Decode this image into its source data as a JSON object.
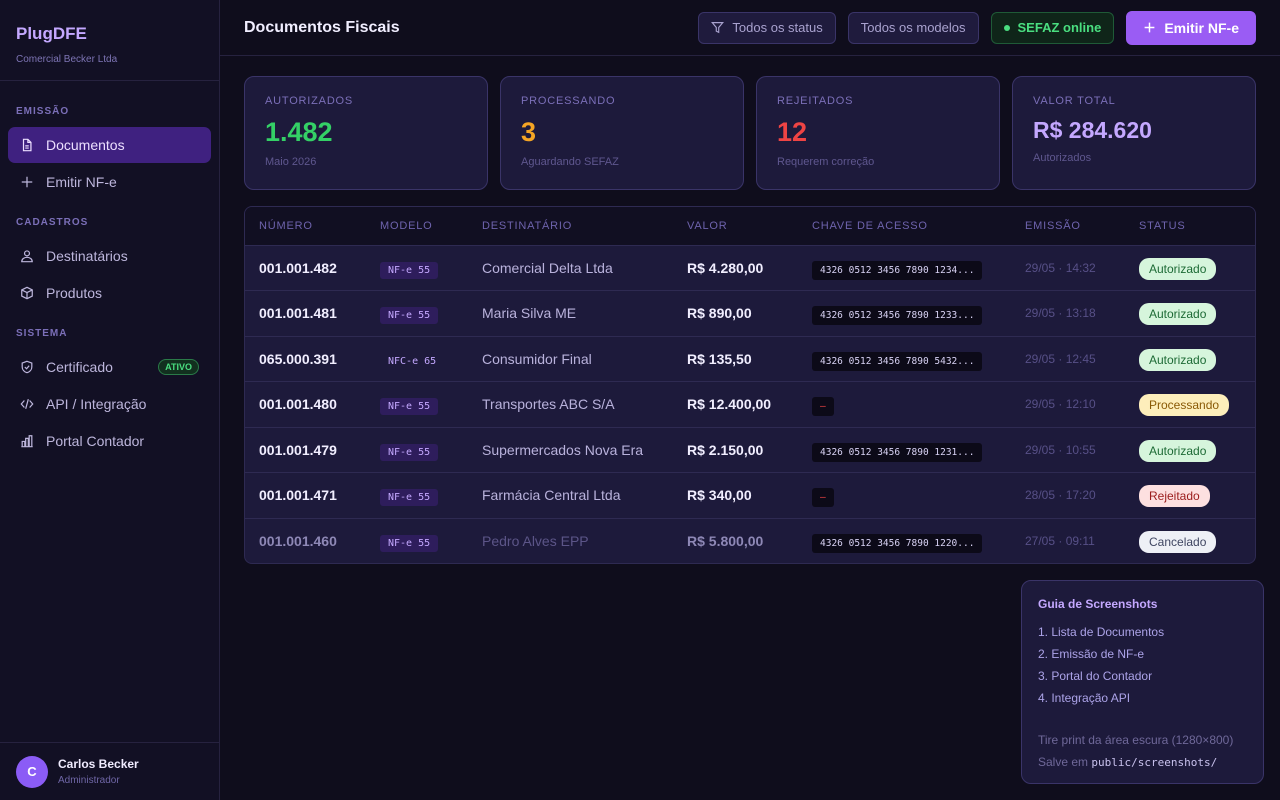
{
  "brand": {
    "name": "PlugDFE",
    "company": "Comercial Becker Ltda"
  },
  "sidebar": {
    "sections": [
      "EMISSÃO",
      "CADASTROS",
      "SISTEMA"
    ],
    "items": [
      {
        "label": "Documentos",
        "icon": "document-icon"
      },
      {
        "label": "Emitir NF-e",
        "icon": "plus-icon"
      },
      {
        "label": "Destinatários",
        "icon": "users-icon"
      },
      {
        "label": "Produtos",
        "icon": "box-icon"
      },
      {
        "label": "Certificado",
        "icon": "shield-icon",
        "badge": "ATIVO"
      },
      {
        "label": "API / Integração",
        "icon": "code-icon"
      },
      {
        "label": "Portal Contador",
        "icon": "bar-chart-icon"
      }
    ]
  },
  "user": {
    "initial": "C",
    "name": "Carlos Becker",
    "role": "Administrador"
  },
  "header": {
    "title": "Documentos Fiscais",
    "filter_status": "Todos os status",
    "filter_models": "Todos os modelos",
    "sefaz": "SEFAZ online",
    "emit": "Emitir NF-e"
  },
  "stats": [
    {
      "label": "AUTORIZADOS",
      "value": "1.482",
      "sub": "Maio 2026"
    },
    {
      "label": "PROCESSANDO",
      "value": "3",
      "sub": "Aguardando SEFAZ"
    },
    {
      "label": "REJEITADOS",
      "value": "12",
      "sub": "Requerem correção"
    },
    {
      "label": "VALOR TOTAL",
      "value": "R$ 284.620",
      "sub": "Autorizados"
    }
  ],
  "table": {
    "columns": [
      "NÚMERO",
      "MODELO",
      "DESTINATÁRIO",
      "VALOR",
      "CHAVE DE ACESSO",
      "EMISSÃO",
      "STATUS"
    ],
    "rows": [
      {
        "num": "001.001.482",
        "model": "NF-e 55",
        "dest": "Comercial Delta Ltda",
        "value": "R$ 4.280,00",
        "key": "4326 0512 3456 7890 1234...",
        "date": "29/05 · 14:32",
        "status": "Autorizado"
      },
      {
        "num": "001.001.481",
        "model": "NF-e 55",
        "dest": "Maria Silva ME",
        "value": "R$ 890,00",
        "key": "4326 0512 3456 7890 1233...",
        "date": "29/05 · 13:18",
        "status": "Autorizado"
      },
      {
        "num": "065.000.391",
        "model": "NFC-e 65",
        "dest": "Consumidor Final",
        "value": "R$ 135,50",
        "key": "4326 0512 3456 7890 5432...",
        "date": "29/05 · 12:45",
        "status": "Autorizado"
      },
      {
        "num": "001.001.480",
        "model": "NF-e 55",
        "dest": "Transportes ABC S/A",
        "value": "R$ 12.400,00",
        "key": "—",
        "date": "29/05 · 12:10",
        "status": "Processando"
      },
      {
        "num": "001.001.479",
        "model": "NF-e 55",
        "dest": "Supermercados Nova Era",
        "value": "R$ 2.150,00",
        "key": "4326 0512 3456 7890 1231...",
        "date": "29/05 · 10:55",
        "status": "Autorizado"
      },
      {
        "num": "001.001.471",
        "model": "NF-e 55",
        "dest": "Farmácia Central Ltda",
        "value": "R$ 340,00",
        "key": "—",
        "date": "28/05 · 17:20",
        "status": "Rejeitado"
      },
      {
        "num": "001.001.460",
        "model": "NF-e 55",
        "dest": "Pedro Alves EPP",
        "value": "R$ 5.800,00",
        "key": "4326 0512 3456 7890 1220...",
        "date": "27/05 · 09:11",
        "status": "Cancelado"
      }
    ]
  },
  "guide": {
    "title": "Guia de Screenshots",
    "items": [
      "1. Lista de Documentos",
      "2. Emissão de NF-e",
      "3. Portal do Contador",
      "4. Integração API"
    ],
    "note1": "Tire print da área escura (1280×800)",
    "note2_prefix": "Salve em",
    "note2_path": "public/screenshots/"
  },
  "colors": {
    "accent": "#9a5cf4",
    "success": "#34d066",
    "warning": "#f5a524",
    "danger": "#ef4444"
  }
}
